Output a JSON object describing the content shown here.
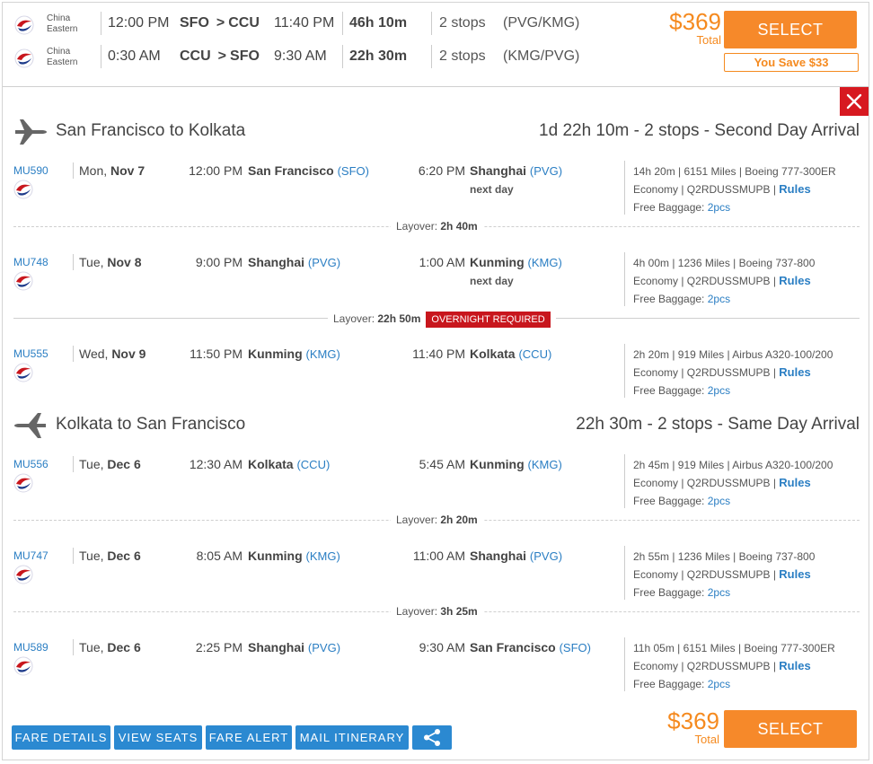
{
  "summary": {
    "rows": [
      {
        "airline": [
          "China",
          "Eastern"
        ],
        "depart": "12:00 PM",
        "origin": "SFO",
        "arrow": ">",
        "destination": "CCU",
        "arrive": "11:40 PM",
        "duration": "46h 10m",
        "stops": "2 stops",
        "via": "(PVG/KMG)"
      },
      {
        "airline": [
          "China",
          "Eastern"
        ],
        "depart": "0:30 AM",
        "origin": "CCU",
        "arrow": ">",
        "destination": "SFO",
        "arrive": "9:30 AM",
        "duration": "22h 30m",
        "stops": "2 stops",
        "via": "(KMG/PVG)"
      }
    ],
    "price": "$369",
    "price_label": "Total",
    "select_label": "SELECT",
    "save_label": "You Save $33"
  },
  "journeys": [
    {
      "title": "San Francisco to Kolkata",
      "summary": "1d 22h 10m - 2 stops - Second Day Arrival",
      "segments": [
        {
          "flight": "MU590",
          "dow": "Mon, ",
          "date": "Nov 7",
          "dep_time": "12:00 PM",
          "dep_city": "San Francisco",
          "dep_code": "(SFO)",
          "arr_time": "6:20 PM",
          "arr_city": "Shanghai",
          "arr_code": "(PVG)",
          "next_day": "next day",
          "info1": "14h 20m | 6151 Miles | Boeing 777-300ER",
          "cabin": "Economy | Q2RDUSSMUPB | ",
          "rules": "Rules",
          "bag": "Free Baggage: ",
          "pcs": "2pcs"
        },
        {
          "flight": "MU748",
          "dow": "Tue, ",
          "date": "Nov 8",
          "dep_time": "9:00 PM",
          "dep_city": "Shanghai",
          "dep_code": "(PVG)",
          "arr_time": "1:00 AM",
          "arr_city": "Kunming",
          "arr_code": "(KMG)",
          "next_day": "next day",
          "info1": "4h 00m | 1236 Miles | Boeing 737-800",
          "cabin": "Economy | Q2RDUSSMUPB | ",
          "rules": "Rules",
          "bag": "Free Baggage: ",
          "pcs": "2pcs"
        },
        {
          "flight": "MU555",
          "dow": "Wed, ",
          "date": "Nov 9",
          "dep_time": "11:50 PM",
          "dep_city": "Kunming",
          "dep_code": "(KMG)",
          "arr_time": "11:40 PM",
          "arr_city": "Kolkata",
          "arr_code": "(CCU)",
          "next_day": "",
          "info1": "2h 20m | 919 Miles | Airbus A320-100/200",
          "cabin": "Economy | Q2RDUSSMUPB | ",
          "rules": "Rules",
          "bag": "Free Baggage: ",
          "pcs": "2pcs"
        }
      ],
      "layovers": [
        {
          "label": "Layover: ",
          "time": "2h 40m",
          "badge": ""
        },
        {
          "label": "Layover: ",
          "time": "22h 50m",
          "badge": "OVERNIGHT REQUIRED"
        }
      ]
    },
    {
      "title": "Kolkata to San Francisco",
      "summary": "22h 30m - 2 stops - Same Day Arrival",
      "segments": [
        {
          "flight": "MU556",
          "dow": "Tue, ",
          "date": "Dec 6",
          "dep_time": "12:30 AM",
          "dep_city": "Kolkata",
          "dep_code": "(CCU)",
          "arr_time": "5:45 AM",
          "arr_city": "Kunming",
          "arr_code": "(KMG)",
          "next_day": "",
          "info1": "2h 45m | 919 Miles | Airbus A320-100/200",
          "cabin": "Economy | Q2RDUSSMUPB | ",
          "rules": "Rules",
          "bag": "Free Baggage: ",
          "pcs": "2pcs"
        },
        {
          "flight": "MU747",
          "dow": "Tue, ",
          "date": "Dec 6",
          "dep_time": "8:05 AM",
          "dep_city": "Kunming",
          "dep_code": "(KMG)",
          "arr_time": "11:00 AM",
          "arr_city": "Shanghai",
          "arr_code": "(PVG)",
          "next_day": "",
          "info1": "2h 55m | 1236 Miles | Boeing 737-800",
          "cabin": "Economy | Q2RDUSSMUPB | ",
          "rules": "Rules",
          "bag": "Free Baggage: ",
          "pcs": "2pcs"
        },
        {
          "flight": "MU589",
          "dow": "Tue, ",
          "date": "Dec 6",
          "dep_time": "2:25 PM",
          "dep_city": "Shanghai",
          "dep_code": "(PVG)",
          "arr_time": "9:30 AM",
          "arr_city": "San Francisco",
          "arr_code": "(SFO)",
          "next_day": "",
          "info1": "11h 05m | 6151 Miles | Boeing 777-300ER",
          "cabin": "Economy | Q2RDUSSMUPB | ",
          "rules": "Rules",
          "bag": "Free Baggage: ",
          "pcs": "2pcs"
        }
      ],
      "layovers": [
        {
          "label": "Layover: ",
          "time": "2h 20m",
          "badge": ""
        },
        {
          "label": "Layover: ",
          "time": "3h 25m",
          "badge": ""
        }
      ]
    }
  ],
  "footer": {
    "buttons": [
      "FARE DETAILS",
      "VIEW SEATS",
      "FARE ALERT",
      "MAIL ITINERARY"
    ],
    "share_icon": "share-icon",
    "price": "$369",
    "price_label": "Total",
    "select_label": "SELECT"
  },
  "icons": {
    "close": "close-icon",
    "airline_logo": "china-eastern-logo-icon",
    "outbound": "plane-right-icon",
    "return": "plane-left-icon"
  },
  "colors": {
    "accent_orange": "#f6892a",
    "link_blue": "#2a7ec3",
    "button_blue": "#2b89d1",
    "alert_red": "#c8161d"
  }
}
